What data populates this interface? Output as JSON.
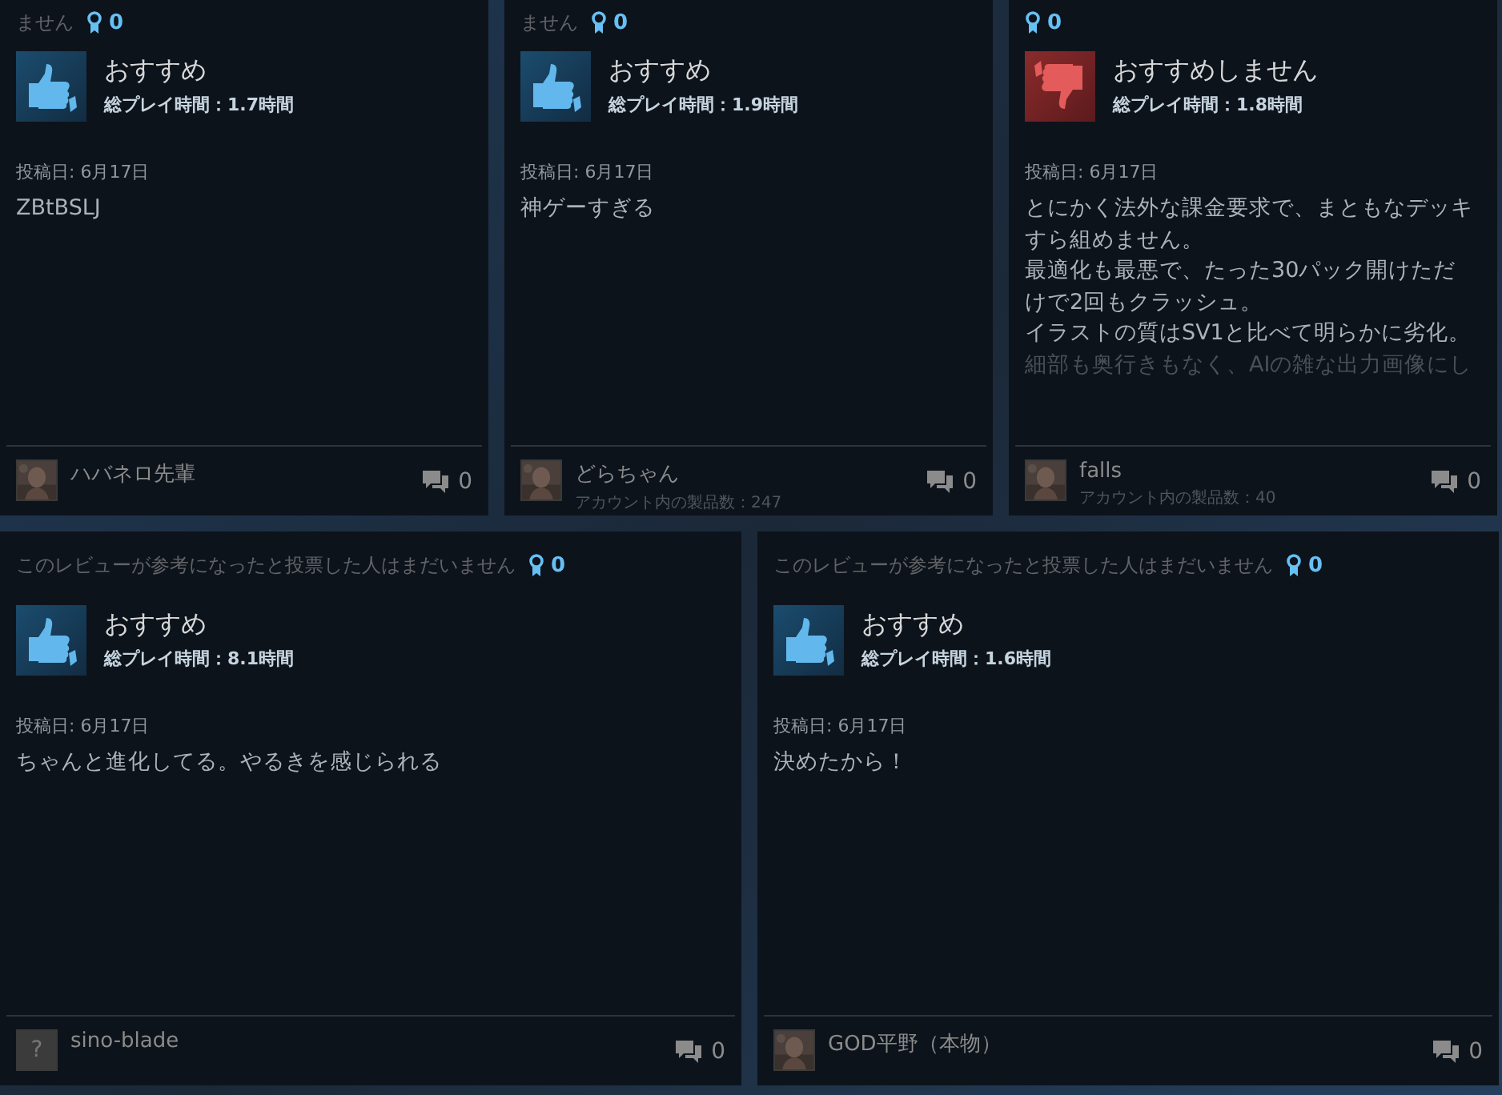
{
  "rows": [
    {
      "reviews": [
        {
          "helpful_text": "ません",
          "awards": "0",
          "recommended": true,
          "verdict": "おすすめ",
          "hours": "総プレイ時間：1.7時間",
          "posted": "投稿日: 6月17日",
          "body": [
            {
              "text": "ZBtBSLJ",
              "faded": false
            }
          ],
          "author": "ハバネロ先輩",
          "avatar": {
            "kind": "picture"
          },
          "comments": "0"
        },
        {
          "helpful_text": "ません",
          "awards": "0",
          "recommended": true,
          "verdict": "おすすめ",
          "hours": "総プレイ時間：1.9時間",
          "posted": "投稿日: 6月17日",
          "body": [
            {
              "text": "神ゲーすぎる",
              "faded": false
            }
          ],
          "author": "どらちゃん",
          "products": "アカウント内の製品数：247",
          "avatar": {
            "kind": "picture"
          },
          "comments": "0"
        },
        {
          "awards": "0",
          "recommended": false,
          "verdict": "おすすめしません",
          "hours": "総プレイ時間：1.8時間",
          "posted": "投稿日: 6月17日",
          "body": [
            {
              "text": "とにかく法外な課金要求で、まともなデッキ",
              "faded": false
            },
            {
              "text": "すら組めません。",
              "faded": false
            },
            {
              "text": "最適化も最悪で、たった30パック開けただ",
              "faded": false
            },
            {
              "text": "けで2回もクラッシュ。",
              "faded": false
            },
            {
              "text": "イラストの質はSV1と比べて明らかに劣化。",
              "faded": false
            },
            {
              "text": "細部も奥行きもなく、AIの雑な出力画像にし",
              "faded": true
            }
          ],
          "author": "falls",
          "products": "アカウント内の製品数：40",
          "avatar": {
            "kind": "picture"
          },
          "comments": "0"
        }
      ]
    },
    {
      "reviews": [
        {
          "helpful_text": "このレビューが参考になったと投票した人はまだいません",
          "awards": "0",
          "recommended": true,
          "verdict": "おすすめ",
          "hours": "総プレイ時間：8.1時間",
          "posted": "投稿日: 6月17日",
          "body": [
            {
              "text": "ちゃんと進化してる。やるきを感じられる",
              "faded": false
            }
          ],
          "author": "sino-blade",
          "avatar": {
            "kind": "default",
            "glyph": "?"
          },
          "comments": "0"
        },
        {
          "helpful_text": "このレビューが参考になったと投票した人はまだいません",
          "awards": "0",
          "recommended": true,
          "verdict": "おすすめ",
          "hours": "総プレイ時間：1.6時間",
          "posted": "投稿日: 6月17日",
          "body": [
            {
              "text": "決めたから！",
              "faded": false
            }
          ],
          "author": "GOD平野（本物）",
          "avatar": {
            "kind": "picture"
          },
          "comments": "0"
        }
      ]
    }
  ]
}
